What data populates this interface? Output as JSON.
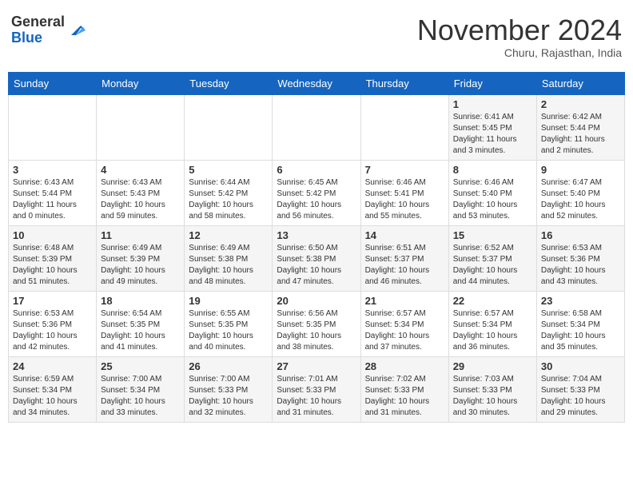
{
  "header": {
    "logo_line1": "General",
    "logo_line2": "Blue",
    "month_title": "November 2024",
    "subtitle": "Churu, Rajasthan, India"
  },
  "weekdays": [
    "Sunday",
    "Monday",
    "Tuesday",
    "Wednesday",
    "Thursday",
    "Friday",
    "Saturday"
  ],
  "weeks": [
    [
      {
        "day": "",
        "info": ""
      },
      {
        "day": "",
        "info": ""
      },
      {
        "day": "",
        "info": ""
      },
      {
        "day": "",
        "info": ""
      },
      {
        "day": "",
        "info": ""
      },
      {
        "day": "1",
        "info": "Sunrise: 6:41 AM\nSunset: 5:45 PM\nDaylight: 11 hours\nand 3 minutes."
      },
      {
        "day": "2",
        "info": "Sunrise: 6:42 AM\nSunset: 5:44 PM\nDaylight: 11 hours\nand 2 minutes."
      }
    ],
    [
      {
        "day": "3",
        "info": "Sunrise: 6:43 AM\nSunset: 5:44 PM\nDaylight: 11 hours\nand 0 minutes."
      },
      {
        "day": "4",
        "info": "Sunrise: 6:43 AM\nSunset: 5:43 PM\nDaylight: 10 hours\nand 59 minutes."
      },
      {
        "day": "5",
        "info": "Sunrise: 6:44 AM\nSunset: 5:42 PM\nDaylight: 10 hours\nand 58 minutes."
      },
      {
        "day": "6",
        "info": "Sunrise: 6:45 AM\nSunset: 5:42 PM\nDaylight: 10 hours\nand 56 minutes."
      },
      {
        "day": "7",
        "info": "Sunrise: 6:46 AM\nSunset: 5:41 PM\nDaylight: 10 hours\nand 55 minutes."
      },
      {
        "day": "8",
        "info": "Sunrise: 6:46 AM\nSunset: 5:40 PM\nDaylight: 10 hours\nand 53 minutes."
      },
      {
        "day": "9",
        "info": "Sunrise: 6:47 AM\nSunset: 5:40 PM\nDaylight: 10 hours\nand 52 minutes."
      }
    ],
    [
      {
        "day": "10",
        "info": "Sunrise: 6:48 AM\nSunset: 5:39 PM\nDaylight: 10 hours\nand 51 minutes."
      },
      {
        "day": "11",
        "info": "Sunrise: 6:49 AM\nSunset: 5:39 PM\nDaylight: 10 hours\nand 49 minutes."
      },
      {
        "day": "12",
        "info": "Sunrise: 6:49 AM\nSunset: 5:38 PM\nDaylight: 10 hours\nand 48 minutes."
      },
      {
        "day": "13",
        "info": "Sunrise: 6:50 AM\nSunset: 5:38 PM\nDaylight: 10 hours\nand 47 minutes."
      },
      {
        "day": "14",
        "info": "Sunrise: 6:51 AM\nSunset: 5:37 PM\nDaylight: 10 hours\nand 46 minutes."
      },
      {
        "day": "15",
        "info": "Sunrise: 6:52 AM\nSunset: 5:37 PM\nDaylight: 10 hours\nand 44 minutes."
      },
      {
        "day": "16",
        "info": "Sunrise: 6:53 AM\nSunset: 5:36 PM\nDaylight: 10 hours\nand 43 minutes."
      }
    ],
    [
      {
        "day": "17",
        "info": "Sunrise: 6:53 AM\nSunset: 5:36 PM\nDaylight: 10 hours\nand 42 minutes."
      },
      {
        "day": "18",
        "info": "Sunrise: 6:54 AM\nSunset: 5:35 PM\nDaylight: 10 hours\nand 41 minutes."
      },
      {
        "day": "19",
        "info": "Sunrise: 6:55 AM\nSunset: 5:35 PM\nDaylight: 10 hours\nand 40 minutes."
      },
      {
        "day": "20",
        "info": "Sunrise: 6:56 AM\nSunset: 5:35 PM\nDaylight: 10 hours\nand 38 minutes."
      },
      {
        "day": "21",
        "info": "Sunrise: 6:57 AM\nSunset: 5:34 PM\nDaylight: 10 hours\nand 37 minutes."
      },
      {
        "day": "22",
        "info": "Sunrise: 6:57 AM\nSunset: 5:34 PM\nDaylight: 10 hours\nand 36 minutes."
      },
      {
        "day": "23",
        "info": "Sunrise: 6:58 AM\nSunset: 5:34 PM\nDaylight: 10 hours\nand 35 minutes."
      }
    ],
    [
      {
        "day": "24",
        "info": "Sunrise: 6:59 AM\nSunset: 5:34 PM\nDaylight: 10 hours\nand 34 minutes."
      },
      {
        "day": "25",
        "info": "Sunrise: 7:00 AM\nSunset: 5:34 PM\nDaylight: 10 hours\nand 33 minutes."
      },
      {
        "day": "26",
        "info": "Sunrise: 7:00 AM\nSunset: 5:33 PM\nDaylight: 10 hours\nand 32 minutes."
      },
      {
        "day": "27",
        "info": "Sunrise: 7:01 AM\nSunset: 5:33 PM\nDaylight: 10 hours\nand 31 minutes."
      },
      {
        "day": "28",
        "info": "Sunrise: 7:02 AM\nSunset: 5:33 PM\nDaylight: 10 hours\nand 31 minutes."
      },
      {
        "day": "29",
        "info": "Sunrise: 7:03 AM\nSunset: 5:33 PM\nDaylight: 10 hours\nand 30 minutes."
      },
      {
        "day": "30",
        "info": "Sunrise: 7:04 AM\nSunset: 5:33 PM\nDaylight: 10 hours\nand 29 minutes."
      }
    ]
  ]
}
